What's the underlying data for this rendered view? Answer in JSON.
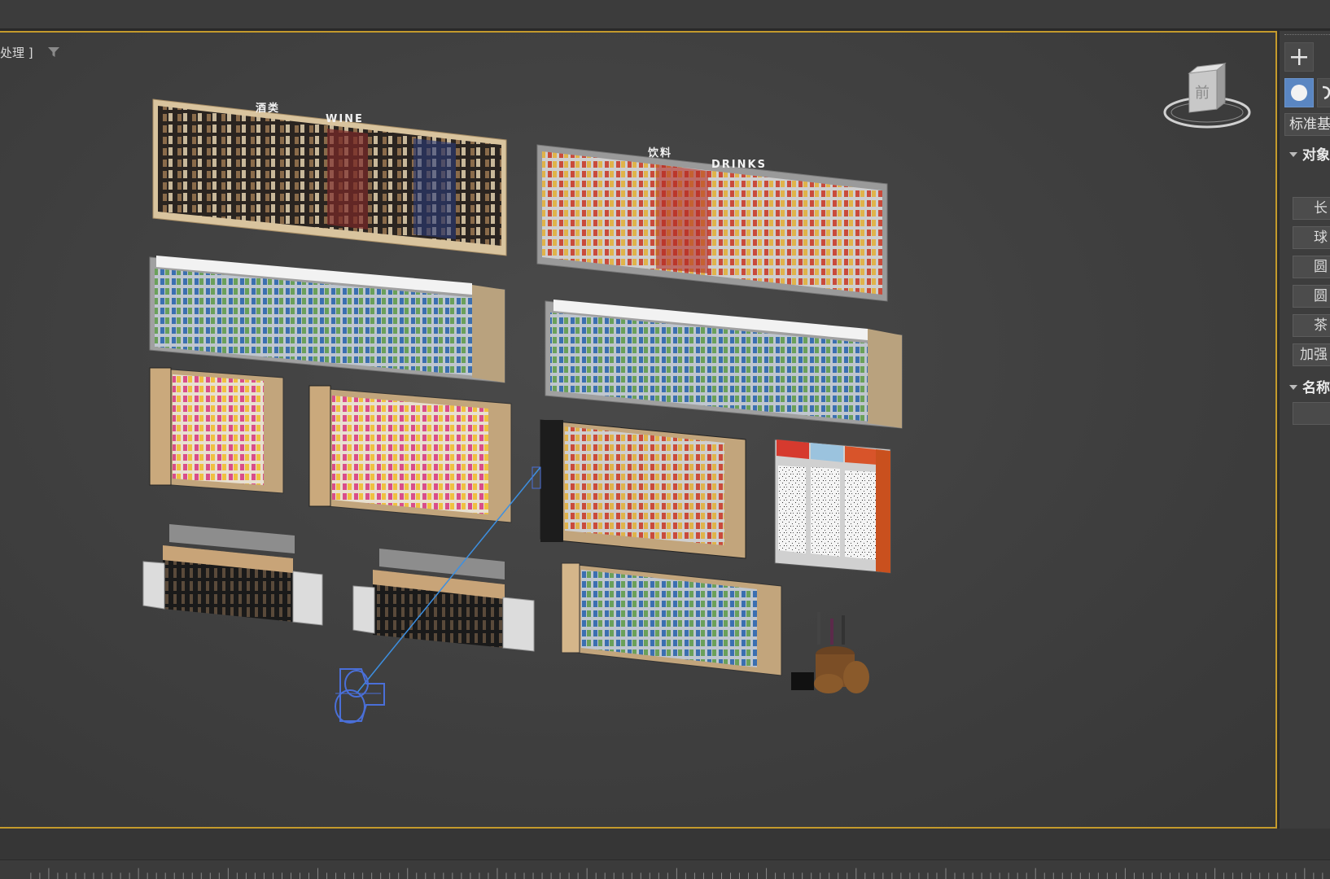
{
  "viewport": {
    "label": "处理 ]",
    "filter_icon": "filter-funnel-icon"
  },
  "scene": {
    "wine_header_cn": "酒类",
    "wine_header_en": "WINE",
    "drinks_header_cn": "饮料",
    "drinks_header_en": "DRINKS"
  },
  "viewcube": {
    "face_label": "前"
  },
  "command_panel": {
    "create_icon": "plus-icon",
    "geometry_icon": "sphere-icon",
    "category_dropdown": "标准基",
    "object_type_rollout": "对象",
    "object_buttons": [
      "长",
      "球",
      "圆",
      "圆",
      "茶",
      "加强"
    ],
    "name_rollout": "名称"
  },
  "colors": {
    "viewport_border": "#c49a2c",
    "selected_camera": "#4a6fd8",
    "active_button": "#5a86c2"
  }
}
